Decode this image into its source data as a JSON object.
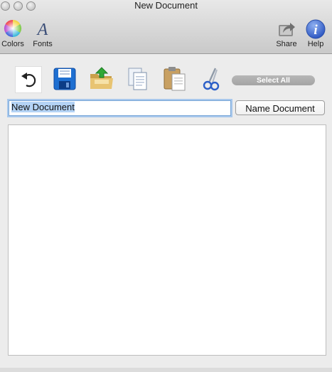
{
  "window": {
    "title": "New Document",
    "traffic_lights": [
      "close",
      "minimize",
      "zoom"
    ]
  },
  "toolbar": {
    "colors_label": "Colors",
    "fonts_label": "Fonts",
    "share_label": "Share",
    "help_label": "Help"
  },
  "actions": {
    "undo_icon": "undo-icon",
    "save_icon": "floppy-disk-icon",
    "open_icon": "open-folder-icon",
    "copy_icon": "copy-documents-icon",
    "paste_icon": "paste-clipboard-icon",
    "cut_icon": "scissors-icon",
    "select_all_label": "Select All"
  },
  "document": {
    "name_value": "New Document",
    "name_button_label": "Name Document",
    "body_text": ""
  },
  "colors": {
    "focus_ring": "#a8c8ec",
    "selection": "#b4d3f5",
    "save_blue": "#1e6fd1",
    "help_blue": "#3d6fd0"
  }
}
